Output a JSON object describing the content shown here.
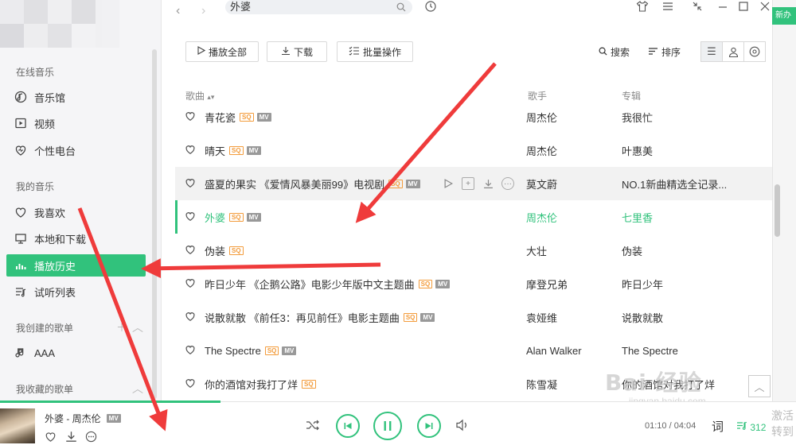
{
  "sidebar": {
    "section_online": "在线音乐",
    "online_items": [
      {
        "label": "音乐馆",
        "icon": "music-hall-icon"
      },
      {
        "label": "视频",
        "icon": "video-icon"
      },
      {
        "label": "个性电台",
        "icon": "radio-icon"
      }
    ],
    "section_mine": "我的音乐",
    "mine_items": [
      {
        "label": "我喜欢",
        "icon": "heart-icon"
      },
      {
        "label": "本地和下载",
        "icon": "monitor-icon"
      },
      {
        "label": "播放历史",
        "icon": "history-bars-icon",
        "active": true
      },
      {
        "label": "试听列表",
        "icon": "playlist-icon"
      }
    ],
    "section_created": "我创建的歌单",
    "created_items": [
      {
        "label": "AAA",
        "icon": "note-icon"
      }
    ],
    "section_collected": "我收藏的歌单"
  },
  "topbar": {
    "search_value": "外婆",
    "edge_label": "新办"
  },
  "toolbar": {
    "play_all": "播放全部",
    "download": "下载",
    "batch": "批量操作",
    "search": "搜索",
    "sort": "排序"
  },
  "table": {
    "headers": {
      "song": "歌曲",
      "singer": "歌手",
      "album": "专辑"
    },
    "rows": [
      {
        "title": "青花瓷",
        "sq": true,
        "mv": true,
        "singer": "周杰伦",
        "album": "我很忙"
      },
      {
        "title": "晴天",
        "sq": true,
        "mv": true,
        "singer": "周杰伦",
        "album": "叶惠美"
      },
      {
        "title": "盛夏的果实 《爱情风暴美丽99》电视剧",
        "sq": true,
        "mv": true,
        "singer": "莫文蔚",
        "album": "NO.1新曲精选全记录...",
        "hover": true
      },
      {
        "title": "外婆",
        "sq": true,
        "mv": true,
        "singer": "周杰伦",
        "album": "七里香",
        "playing": true
      },
      {
        "title": "伪装",
        "sq": true,
        "mv": false,
        "singer": "大壮",
        "album": "伪装"
      },
      {
        "title": "昨日少年 《企鹅公路》电影少年版中文主题曲",
        "sq": true,
        "mv": true,
        "singer": "摩登兄弟",
        "album": "昨日少年"
      },
      {
        "title": "说散就散 《前任3：再见前任》电影主题曲",
        "sq": true,
        "mv": true,
        "singer": "袁娅维",
        "album": "说散就散"
      },
      {
        "title": "The Spectre",
        "sq": true,
        "mv": true,
        "singer": "Alan Walker",
        "album": "The Spectre"
      },
      {
        "title": "你的酒馆对我打了烊",
        "sq": true,
        "mv": false,
        "singer": "陈雪凝",
        "album": "你的酒馆对我打了烊"
      }
    ],
    "tag_sq": "SQ",
    "tag_mv": "MV"
  },
  "player": {
    "now_playing": "外婆 - 周杰伦",
    "time": "01:10 / 04:04",
    "lyric": "词",
    "queue_count": "312",
    "corner_text_1": "激活",
    "corner_text_2": "转到"
  },
  "watermark": {
    "main": "Bai 经验",
    "sub": "jingyan.baidu.com"
  },
  "colors": {
    "accent": "#31c27c",
    "annotation_arrow": "#ef3b3b"
  }
}
